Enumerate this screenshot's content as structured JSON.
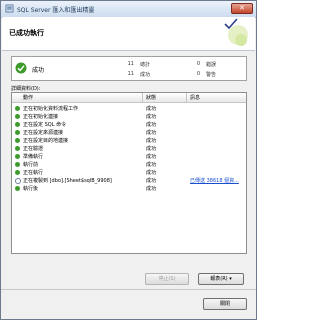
{
  "window": {
    "title": "SQL Server 匯入和匯出精靈",
    "close_glyph": "✕"
  },
  "header": {
    "heading": "已成功執行"
  },
  "status": {
    "result": "成功",
    "stats": [
      {
        "count": "11",
        "label": "總計"
      },
      {
        "count": "11",
        "label": "成功"
      },
      {
        "count": "0",
        "label": "錯誤"
      },
      {
        "count": "0",
        "label": "警告"
      }
    ]
  },
  "details": {
    "label": "詳細資料(D):",
    "columns": [
      "動作",
      "狀態",
      "訊息"
    ],
    "rows": [
      {
        "action": "正在初始化資料流程工作",
        "status": "成功",
        "message": "",
        "icon": "success-icon"
      },
      {
        "action": "正在初始化連接",
        "status": "成功",
        "message": "",
        "icon": "success-icon"
      },
      {
        "action": "正在設定 SQL 命令",
        "status": "成功",
        "message": "",
        "icon": "success-icon"
      },
      {
        "action": "正在設定來源連接",
        "status": "成功",
        "message": "",
        "icon": "success-icon"
      },
      {
        "action": "正在設定目的地連接",
        "status": "成功",
        "message": "",
        "icon": "success-icon"
      },
      {
        "action": "正在驗證",
        "status": "成功",
        "message": "",
        "icon": "success-icon"
      },
      {
        "action": "準備執行",
        "status": "成功",
        "message": "",
        "icon": "success-icon"
      },
      {
        "action": "執行前",
        "status": "成功",
        "message": "",
        "icon": "success-icon"
      },
      {
        "action": "正在執行",
        "status": "成功",
        "message": "",
        "icon": "success-icon"
      },
      {
        "action": "正在複製到 [dbo].[Sheet$sqlB_9908]",
        "status": "成功",
        "message": "已傳送 38618 個資...",
        "icon": "info-icon"
      },
      {
        "action": "執行後",
        "status": "成功",
        "message": "",
        "icon": "success-icon"
      }
    ]
  },
  "buttons": {
    "stop": "停止(S)",
    "report": "報表(R) ▾",
    "close": "關閉"
  },
  "colors": {
    "accent": "#1e395b",
    "success": "#3e9b2b",
    "link": "#1a4fcf"
  }
}
